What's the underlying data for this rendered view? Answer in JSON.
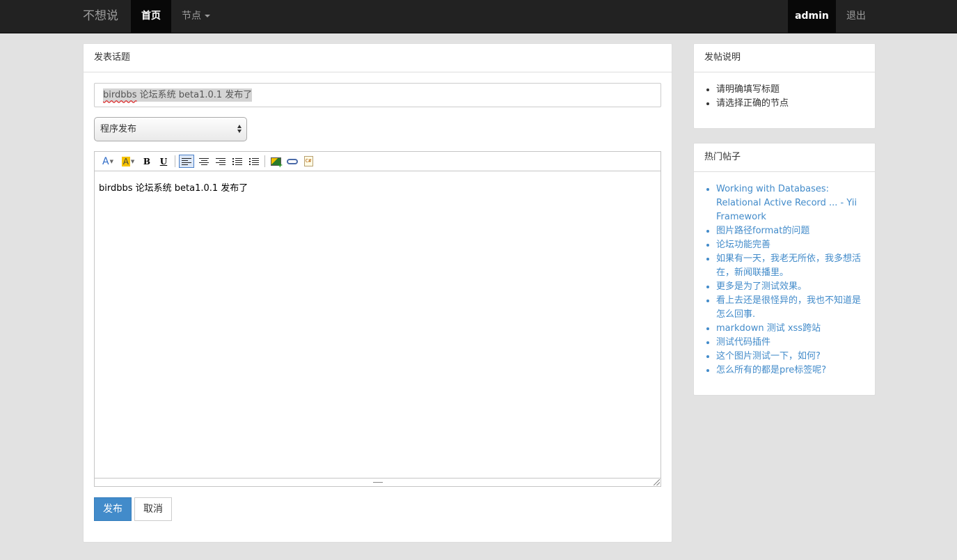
{
  "navbar": {
    "brand": "不想说",
    "home": "首页",
    "nodes": "节点",
    "user": "admin",
    "logout": "退出"
  },
  "compose": {
    "panel_title": "发表话题",
    "title_value_part1": "birdbbs",
    "title_value_part2": " 论坛系统 beta1.0.1 发布了",
    "node_selected": "程序发布",
    "editor_content": "birdbbs 论坛系统 beta1.0.1 发布了",
    "toolbar": {
      "font_color": "A",
      "bg_color": "A",
      "bold": "B",
      "underline": "U",
      "code": "C#"
    },
    "publish_label": "发布",
    "cancel_label": "取消"
  },
  "guide": {
    "title": "发帖说明",
    "items": [
      "请明确填写标题",
      "请选择正确的节点"
    ]
  },
  "hot": {
    "title": "热门帖子",
    "items": [
      "Working with Databases: Relational Active Record ... - Yii Framework",
      "图片路径format的问题",
      "论坛功能完善",
      "如果有一天，我老无所依，我多想活在，新闻联播里。",
      "更多是为了测试效果。",
      "看上去还是很怪异的，我也不知道是怎么回事.",
      "markdown 测试 xss跨站",
      "测试代码插件",
      "这个图片测试一下，如何?",
      "怎么所有的都是pre标签呢?"
    ]
  },
  "colors": {
    "navbar_bg": "#222222",
    "accent": "#428bca",
    "page_bg": "#e2e2e2"
  }
}
